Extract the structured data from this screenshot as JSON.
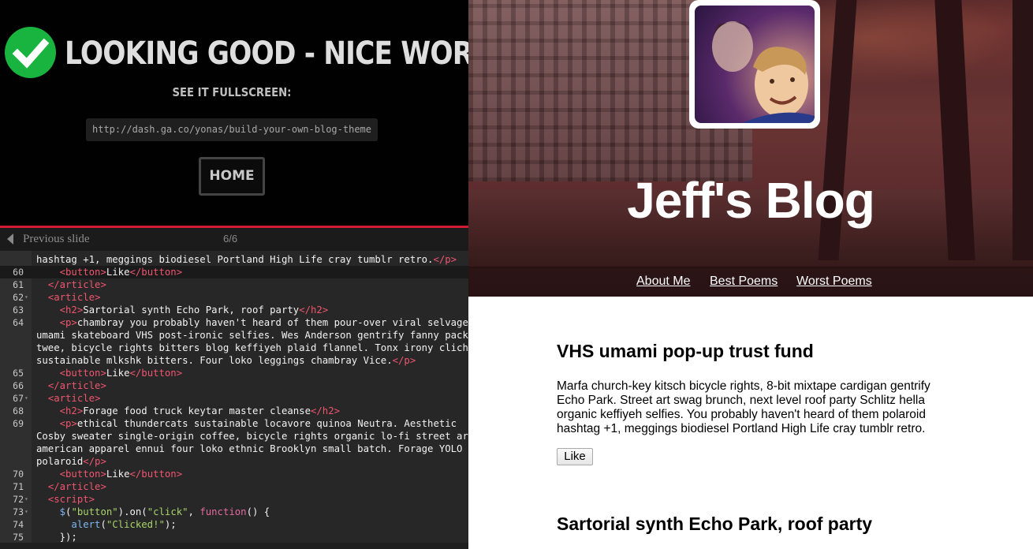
{
  "success": {
    "title": "LOOKING GOOD - NICE WORK!",
    "fullscreen_label": "SEE IT FULLSCREEN:",
    "url": "http://dash.ga.co/yonas/build-your-own-blog-theme",
    "home_label": "HOME",
    "check_color": "#19b43f"
  },
  "slide_nav": {
    "prev_label": "Previous slide",
    "counter": "6/6"
  },
  "editor": {
    "lines": [
      {
        "ln": "",
        "fold": false,
        "html": "hashtag +1, meggings biodiesel Portland High Life cray tumblr retro.<span class='tag'>&lt;/p&gt;</span>"
      },
      {
        "ln": "60",
        "fold": false,
        "html": "    <span class='tag'>&lt;button&gt;</span>Like<span class='tag'>&lt;/button&gt;</span>"
      },
      {
        "ln": "61",
        "fold": false,
        "html": "  <span class='tag'>&lt;/article&gt;</span>"
      },
      {
        "ln": "62",
        "fold": true,
        "html": "  <span class='tag'>&lt;article&gt;</span>"
      },
      {
        "ln": "63",
        "fold": false,
        "html": "    <span class='tag'>&lt;h2&gt;</span>Sartorial synth Echo Park, roof party<span class='tag'>&lt;/h2&gt;</span>"
      },
      {
        "ln": "64",
        "fold": false,
        "html": "    <span class='tag'>&lt;p&gt;</span>chambray you probably haven't heard of them pour-over viral selvage"
      },
      {
        "ln": "",
        "fold": false,
        "html": "umami skateboard VHS post-ironic selfies. Wes Anderson gentrify fanny pack"
      },
      {
        "ln": "",
        "fold": false,
        "html": "twee, bicycle rights bitters blog keffiyeh plaid flannel. Tonx irony cliche"
      },
      {
        "ln": "",
        "fold": false,
        "html": "sustainable mlkshk bitters. Four loko leggings chambray Vice.<span class='tag'>&lt;/p&gt;</span>"
      },
      {
        "ln": "65",
        "fold": false,
        "html": "    <span class='tag'>&lt;button&gt;</span>Like<span class='tag'>&lt;/button&gt;</span>"
      },
      {
        "ln": "66",
        "fold": false,
        "html": "  <span class='tag'>&lt;/article&gt;</span>"
      },
      {
        "ln": "67",
        "fold": true,
        "html": "  <span class='tag'>&lt;article&gt;</span>"
      },
      {
        "ln": "68",
        "fold": false,
        "html": "    <span class='tag'>&lt;h2&gt;</span>Forage food truck keytar master cleanse<span class='tag'>&lt;/h2&gt;</span>"
      },
      {
        "ln": "69",
        "fold": false,
        "html": "    <span class='tag'>&lt;p&gt;</span>ethical thundercats sustainable locavore quinoa Neutra. Aesthetic"
      },
      {
        "ln": "",
        "fold": false,
        "html": "Cosby sweater single-origin coffee, bicycle rights organic lo-fi street art"
      },
      {
        "ln": "",
        "fold": false,
        "html": "american apparel ennui four loko ethnic Brooklyn small batch. Forage YOLO"
      },
      {
        "ln": "",
        "fold": false,
        "html": "polaroid<span class='tag'>&lt;/p&gt;</span>"
      },
      {
        "ln": "70",
        "fold": false,
        "html": "    <span class='tag'>&lt;button&gt;</span>Like<span class='tag'>&lt;/button&gt;</span>"
      },
      {
        "ln": "71",
        "fold": false,
        "html": "  <span class='tag'>&lt;/article&gt;</span>"
      },
      {
        "ln": "72",
        "fold": true,
        "html": "  <span class='tag'>&lt;script&gt;</span>"
      },
      {
        "ln": "73",
        "fold": true,
        "html": "    <span class='fn'>$</span>(<span class='str'>\"button\"</span>).on(<span class='str'>\"click\"</span>, <span class='kw'>function</span>() {"
      },
      {
        "ln": "74",
        "fold": false,
        "html": "      <span class='fn'>alert</span>(<span class='str'>\"Clicked!\"</span>);"
      },
      {
        "ln": "75",
        "fold": false,
        "html": "    });"
      }
    ]
  },
  "blog": {
    "title": "Jeff's Blog",
    "nav": [
      {
        "label": "About Me"
      },
      {
        "label": "Best Poems"
      },
      {
        "label": "Worst Poems"
      }
    ],
    "posts": [
      {
        "title": "VHS umami pop-up trust fund",
        "body": "Marfa church-key kitsch bicycle rights, 8-bit mixtape cardigan gentrify Echo Park. Street art swag brunch, next level roof party Schlitz hella organic keffiyeh selfies. You probably haven't heard of them polaroid hashtag +1, meggings biodiesel Portland High Life cray tumblr retro.",
        "button": "Like"
      },
      {
        "title": "Sartorial synth Echo Park, roof party"
      }
    ]
  }
}
